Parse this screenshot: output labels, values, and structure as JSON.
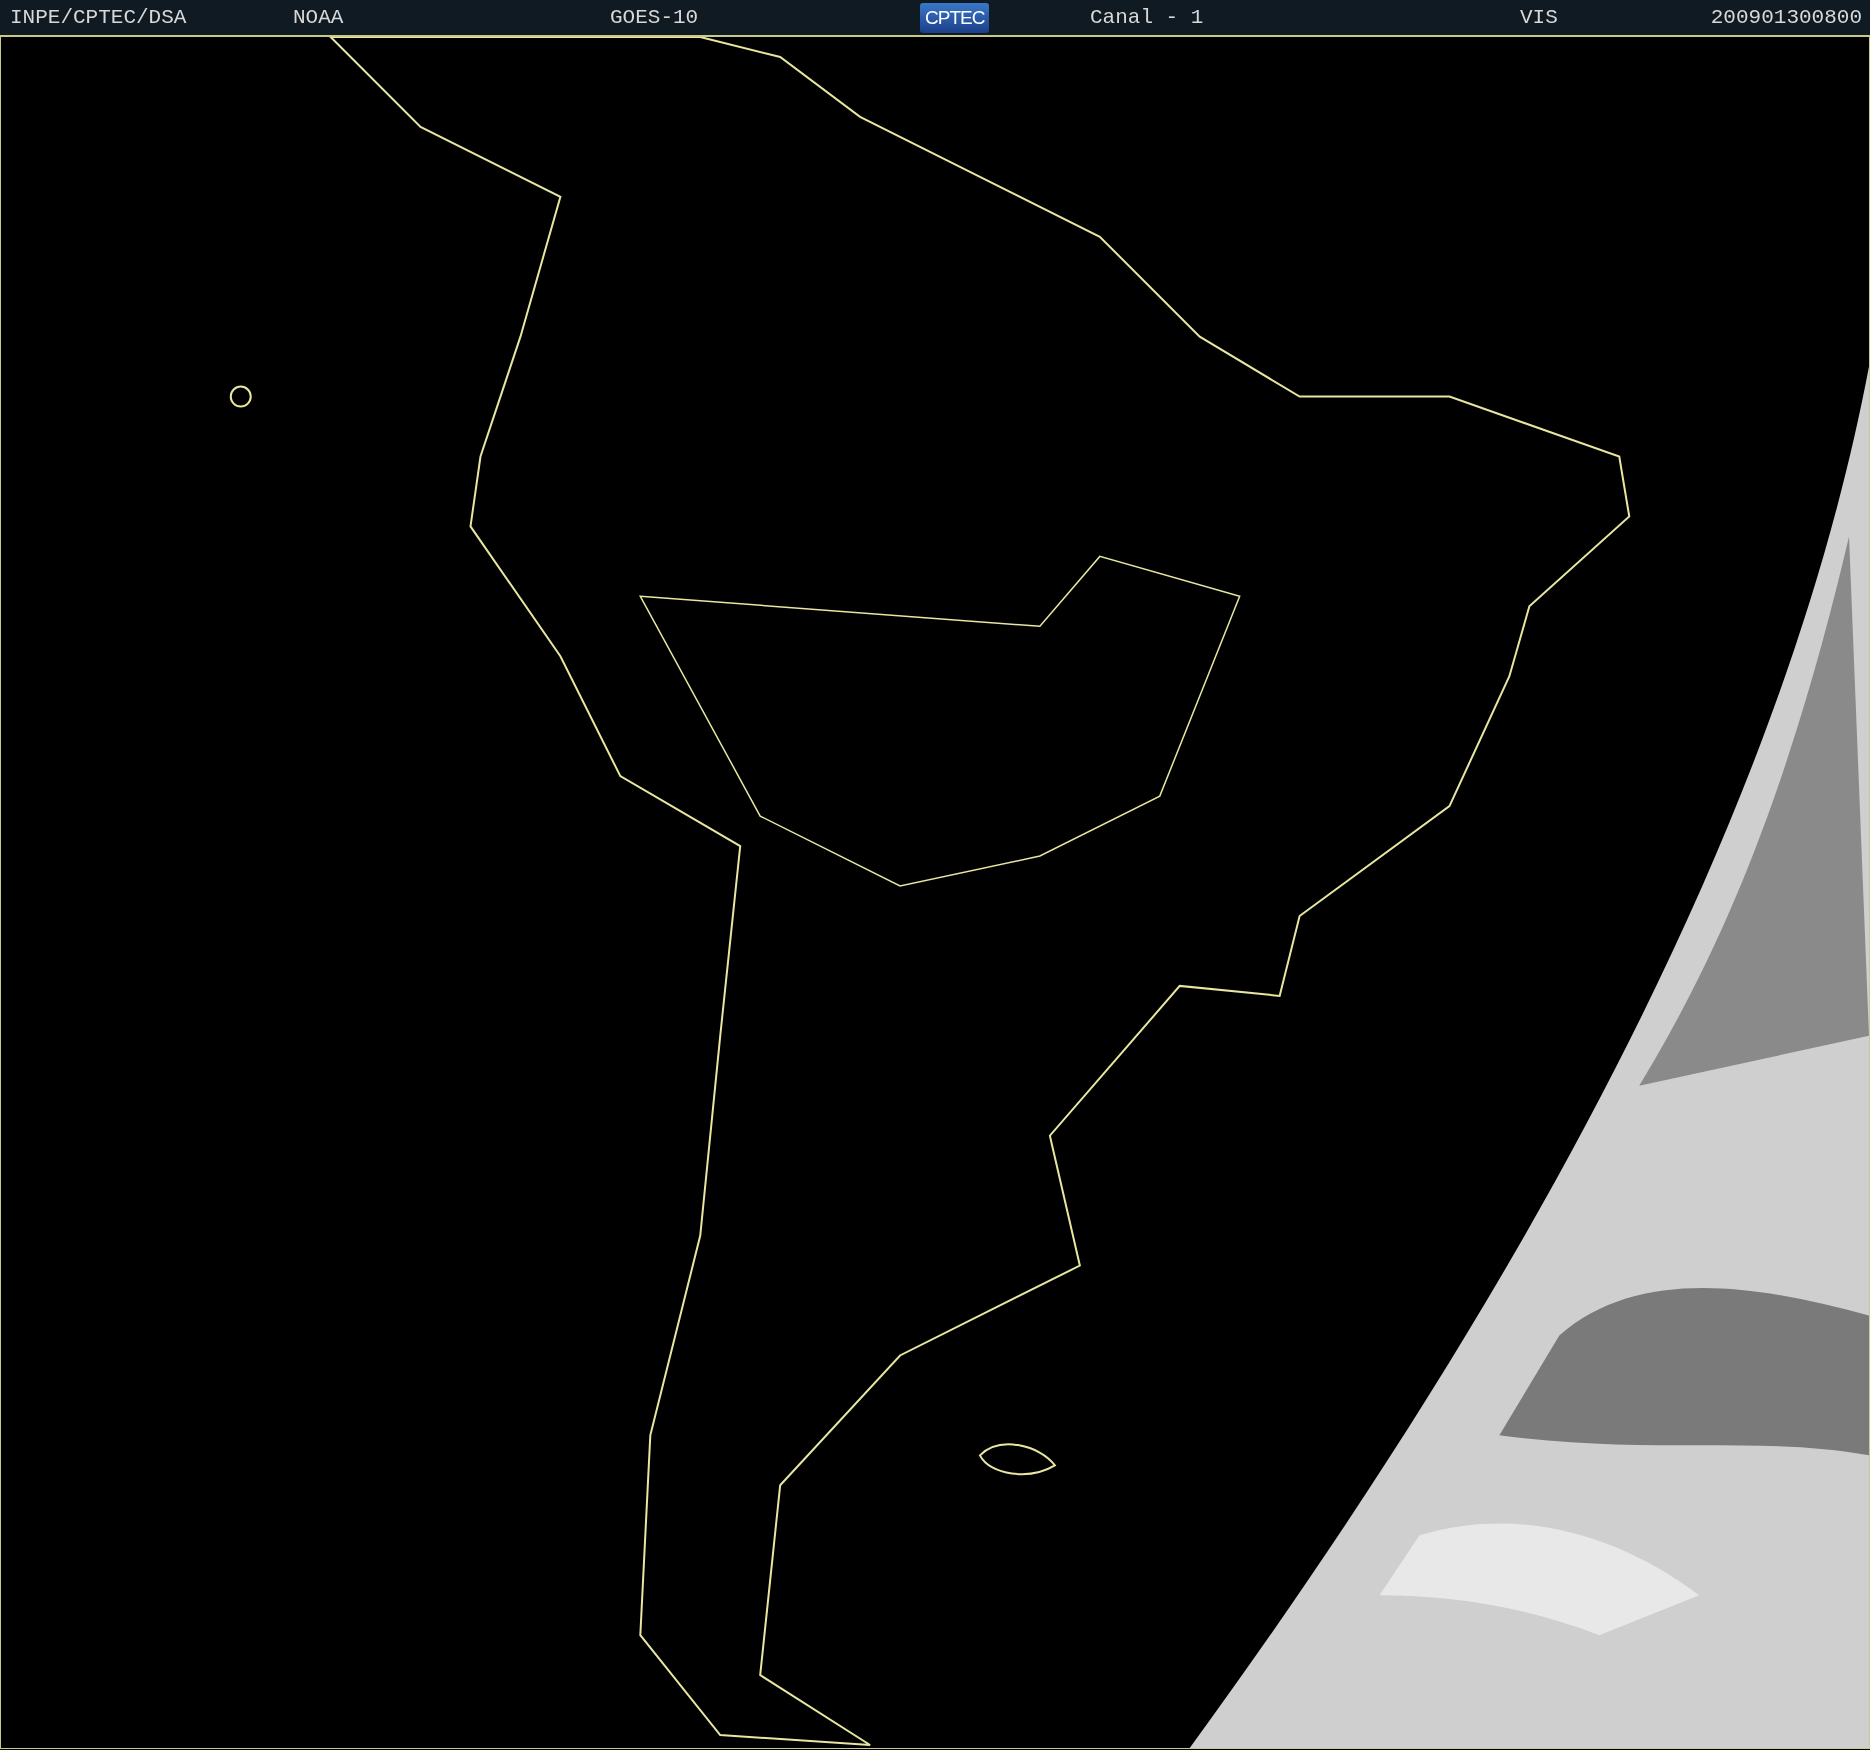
{
  "header": {
    "items": [
      {
        "kind": "text",
        "label": "INPE/CPTEC/DSA"
      },
      {
        "kind": "text",
        "label": "NOAA"
      },
      {
        "kind": "text",
        "label": "GOES-10"
      },
      {
        "kind": "logo",
        "label": "CPTEC"
      },
      {
        "kind": "text",
        "label": "Canal - 1"
      },
      {
        "kind": "text",
        "label": "VIS"
      },
      {
        "kind": "text",
        "label": "200901300800"
      }
    ]
  }
}
